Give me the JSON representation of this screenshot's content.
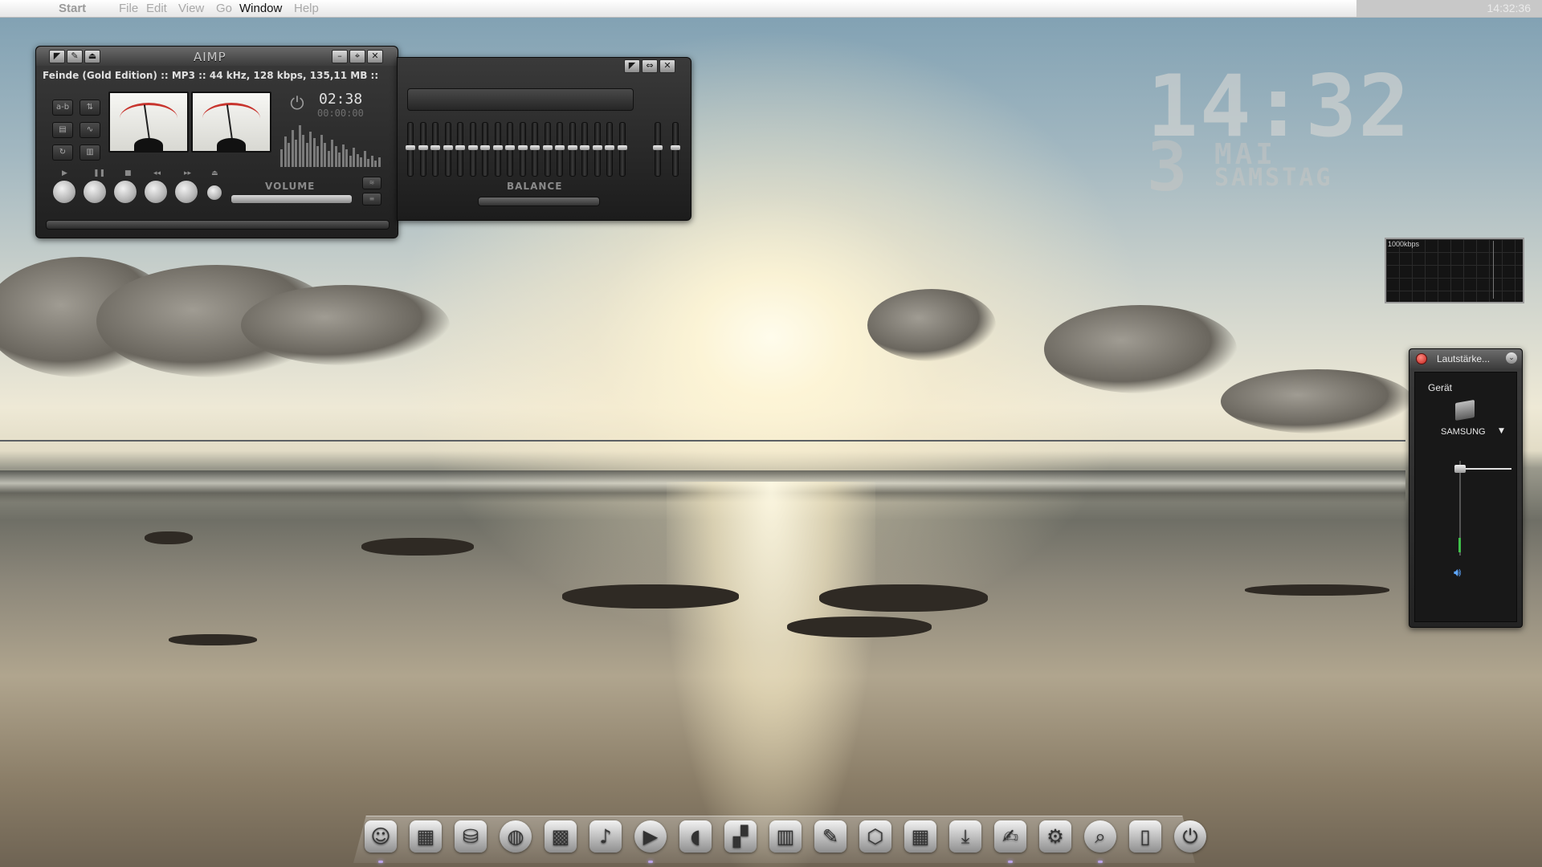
{
  "menubar": {
    "items": [
      "Start",
      "File",
      "Edit",
      "View",
      "Go",
      "Window",
      "Help"
    ],
    "active_item": "Window",
    "clock": "14:32:36"
  },
  "aimp": {
    "title": "AIMP",
    "track_info": "Feinde (Gold Edition) :: MP3 :: 44 kHz, 128 kbps, 135,11 MB ::",
    "time_elapsed": "02:38",
    "time_secondary": "00:00:00",
    "volume_label": "VOLUME",
    "balance_label": "BALANCE",
    "volume_level_percent": 100,
    "balance_position_percent": 50
  },
  "clock_widget": {
    "time": "14:32",
    "day": "3",
    "month": "MAI",
    "weekday": "SAMSTAG"
  },
  "net_meter": {
    "label": "1000kbps"
  },
  "volume_mixer": {
    "title": "Lautstärke...",
    "device_label": "Gerät",
    "device_name": "SAMSUNG",
    "level_percent": 92
  },
  "dock": {
    "icons": [
      "finder-icon",
      "window-icon",
      "drive-icon",
      "browser-icon",
      "photos-icon",
      "guitar-icon",
      "play-icon",
      "speaker-icon",
      "clapper-icon",
      "film-icon",
      "notes-icon",
      "package-icon",
      "calculator-icon",
      "download-icon",
      "text-edit-icon",
      "settings-icon",
      "search-icon",
      "trash-icon",
      "power-icon"
    ]
  },
  "colors": {
    "mixer_close": "#c0231d",
    "meter_green": "#3fbf4a",
    "mute_blue": "#5ea7ff",
    "running_indicator": "#bba5e8"
  }
}
